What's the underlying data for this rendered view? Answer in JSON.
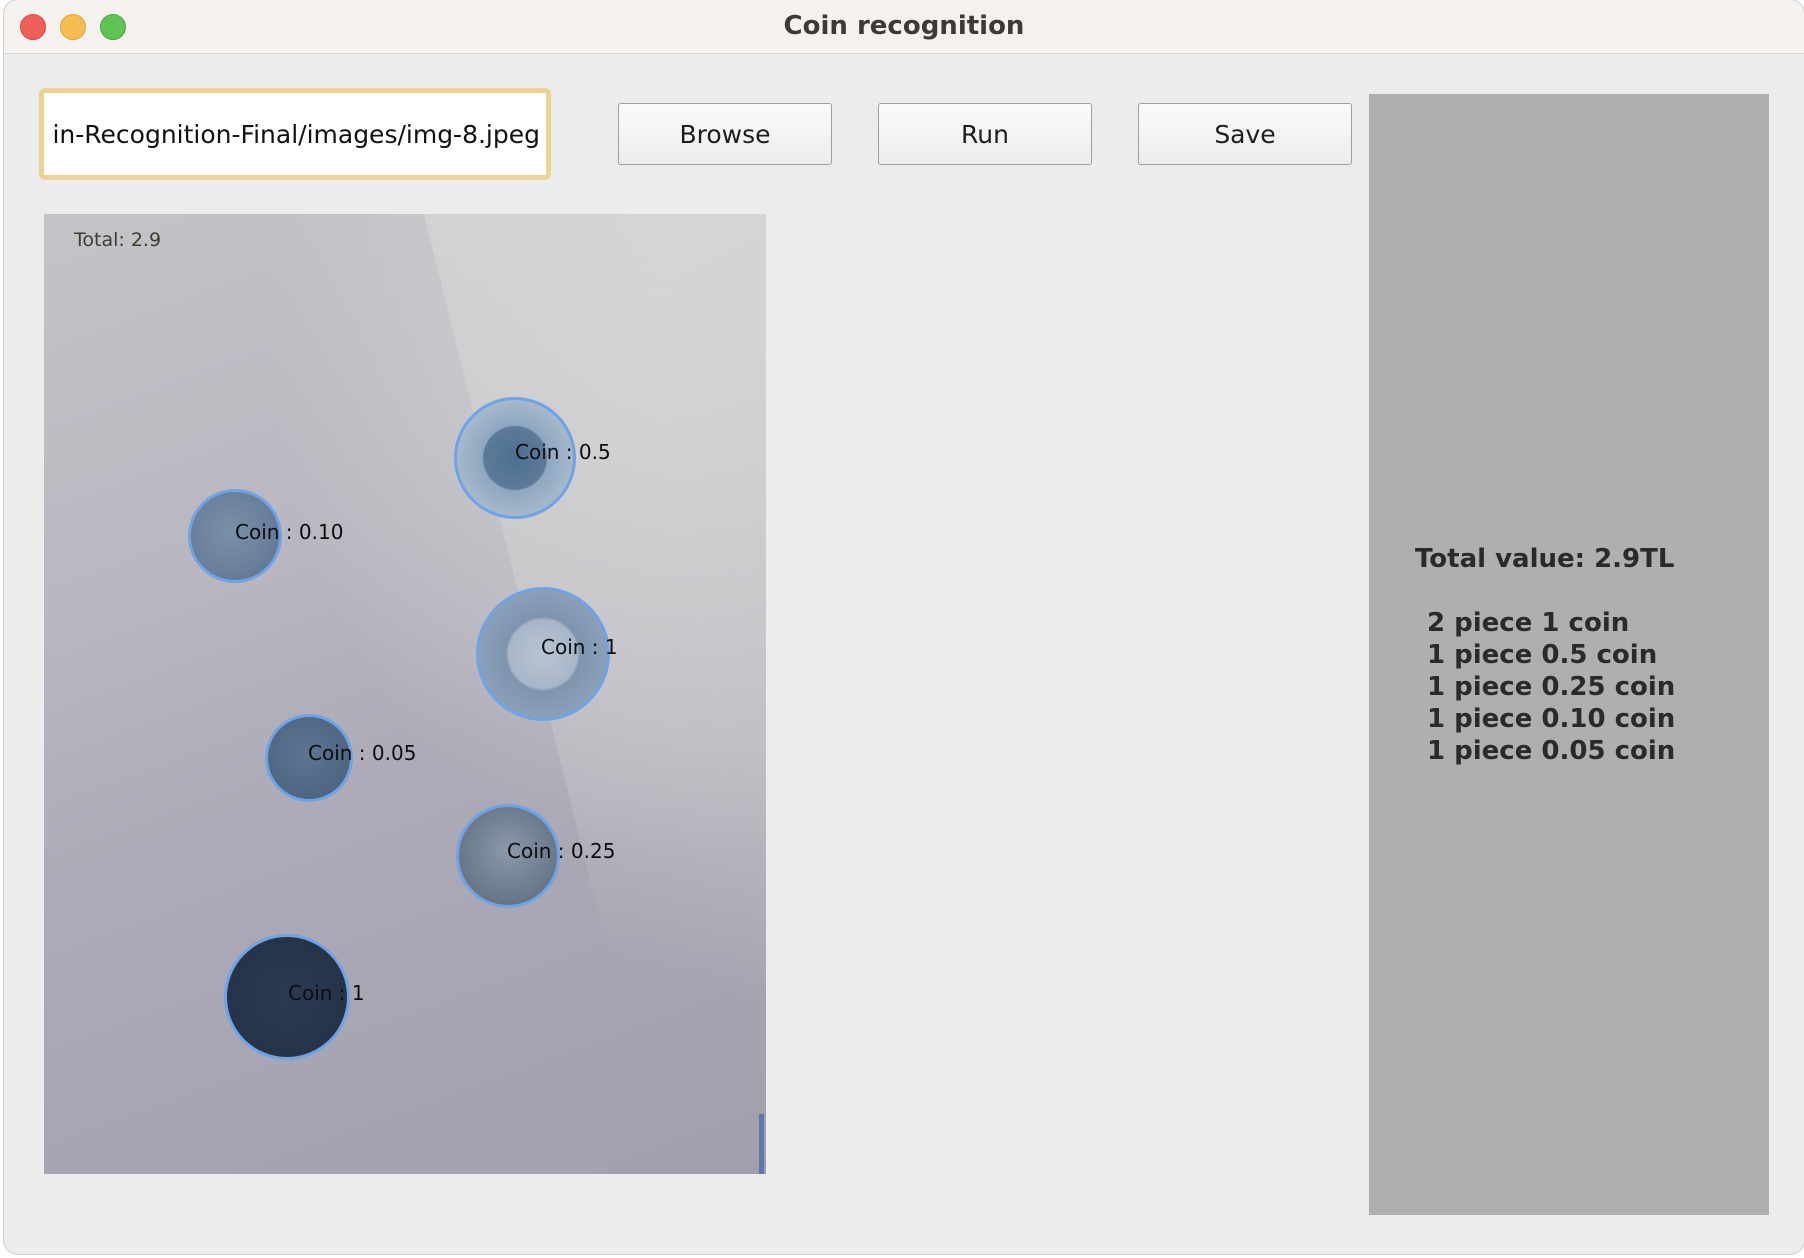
{
  "window": {
    "title": "Coin recognition"
  },
  "toolbar": {
    "path_value": "in-Recognition-Final/images/img-8.jpeg",
    "browse_label": "Browse",
    "run_label": "Run",
    "save_label": "Save"
  },
  "image": {
    "total_overlay": "Total: 2.9",
    "coins": [
      {
        "label": "Coin  :  0.5"
      },
      {
        "label": "Coin  :  0.10"
      },
      {
        "label": "Coin  :  1"
      },
      {
        "label": "Coin  :  0.05"
      },
      {
        "label": "Coin  :  0.25"
      },
      {
        "label": "Coin  :  1"
      }
    ]
  },
  "results": {
    "total_value": "Total value: 2.9TL",
    "breakdown": [
      "2 piece 1 coin",
      "1 piece 0.5 coin",
      "1 piece 0.25 coin",
      "1 piece 0.10 coin",
      "1 piece 0.05 coin"
    ]
  },
  "colors": {
    "window_bg": "#ececec",
    "field_focus_border": "#ecd295",
    "results_panel_bg": "#afafaf",
    "coin_outline": "#6ea3e6"
  }
}
